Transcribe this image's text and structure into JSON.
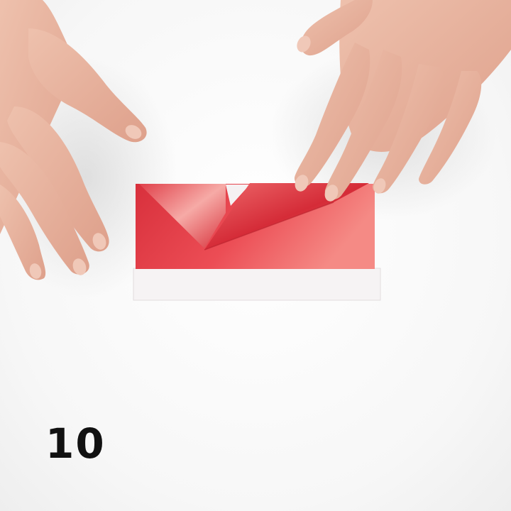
{
  "step": {
    "number": "10"
  },
  "colors": {
    "background": "#fbfbfb",
    "paper_red": "#e63a45",
    "paper_red_light": "#f27c7c",
    "paper_white": "#f6f3f4",
    "skin": "#e9b29f",
    "text": "#111111"
  },
  "icons": {
    "step_marker": "numeric-label"
  }
}
